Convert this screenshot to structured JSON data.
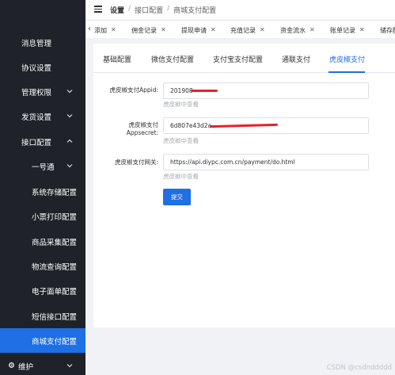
{
  "sidebar": {
    "items": [
      {
        "label": "消息管理"
      },
      {
        "label": "协议设置"
      },
      {
        "label": "管理权限"
      },
      {
        "label": "发货设置"
      },
      {
        "label": "接口配置"
      },
      {
        "label": "一号通"
      },
      {
        "label": "系统存储配置"
      },
      {
        "label": "小票打印配置"
      },
      {
        "label": "商品采集配置"
      },
      {
        "label": "物流查询配置"
      },
      {
        "label": "电子面单配置"
      },
      {
        "label": "短信接口配置"
      },
      {
        "label": "商城支付配置"
      },
      {
        "label": "维护"
      }
    ]
  },
  "header": {
    "breadcrumbs": [
      "设置",
      "接口配置",
      "商城支付配置"
    ],
    "separator": "/"
  },
  "tags": [
    "添加",
    "佣金记录",
    "提现申请",
    "充值记录",
    "资金流水",
    "账单记录",
    "储存配"
  ],
  "tabs": [
    "基础配置",
    "微信支付配置",
    "支付宝支付配置",
    "通联支付",
    "虎皮椒支付"
  ],
  "form": {
    "appid": {
      "label": "虎皮椒支付Appid:",
      "value": "201908",
      "helper": "虎皮椒中查看"
    },
    "appsecret": {
      "label_1": "虎皮椒支付",
      "label_2": "Appsecret:",
      "value": "6d807e43d2a",
      "helper": "虎皮椒中查看"
    },
    "gateway": {
      "label": "虎皮椒支付网关:",
      "value": "https://api.diypc.com.cn/payment/do.html",
      "helper": "虎皮椒中查看"
    },
    "submit_label": "提交"
  },
  "watermark": "CSDN @csdnddddd",
  "colors": {
    "accent": "#1f6fe5",
    "sidebar_bg": "#1f2329",
    "redaction": "#e8202a"
  }
}
